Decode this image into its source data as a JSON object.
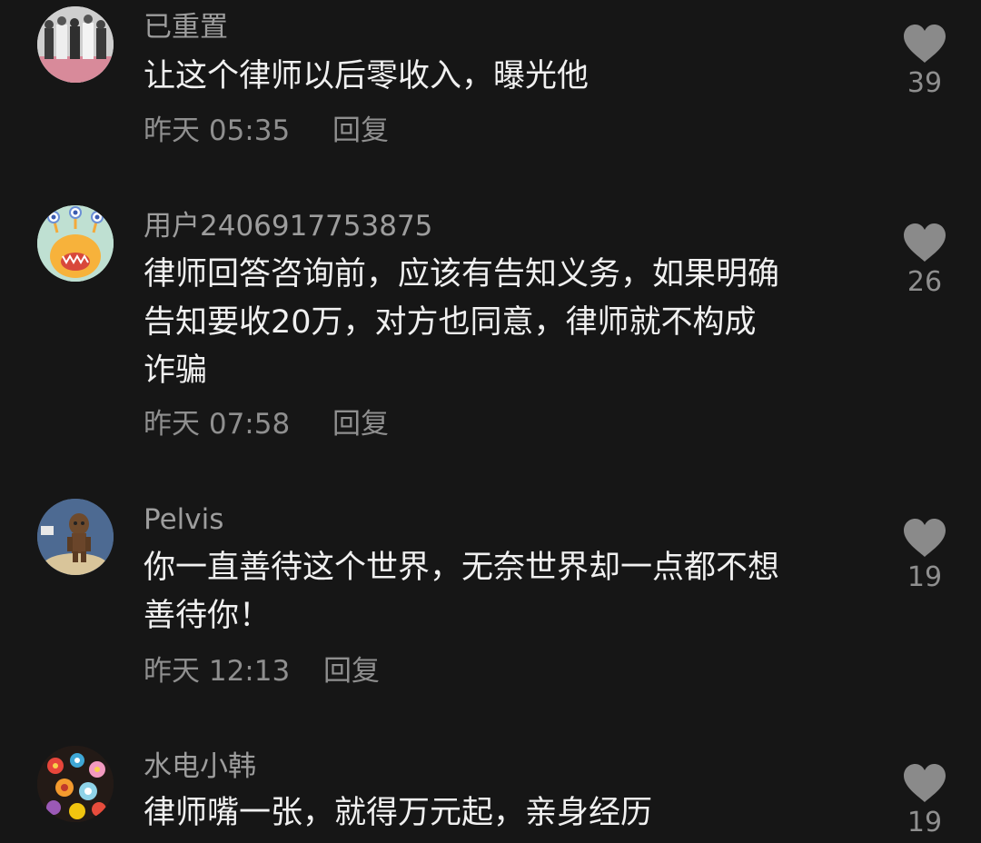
{
  "colors": {
    "background": "#161616",
    "username": "#9d9d9d",
    "content": "#f0f0f0",
    "meta": "#8f8f8f",
    "heart": "#8a8a8a"
  },
  "comments": [
    {
      "username": "已重置",
      "lines": [
        "让这个律师以后零收入，曝光他"
      ],
      "time": "昨天 05:35",
      "reply_label": "回复",
      "likes": "39",
      "like_icon": "heart-icon"
    },
    {
      "username": "用户2406917753875",
      "lines": [
        "律师回答咨询前，应该有告知义务，如果明确",
        "告知要收20万，对方也同意，律师就不构成",
        "诈骗"
      ],
      "time": "昨天 07:58",
      "reply_label": "回复",
      "likes": "26",
      "like_icon": "heart-icon"
    },
    {
      "username": "Pelvis",
      "lines": [
        "你一直善待这个世界，无奈世界却一点都不想",
        "善待你！"
      ],
      "time": "昨天 12:13",
      "reply_label": "回复",
      "likes": "19",
      "like_icon": "heart-icon"
    },
    {
      "username": "水电小韩",
      "lines": [
        "律师嘴一张，就得万元起，亲身经历"
      ],
      "likes": "19",
      "like_icon": "heart-icon"
    }
  ]
}
